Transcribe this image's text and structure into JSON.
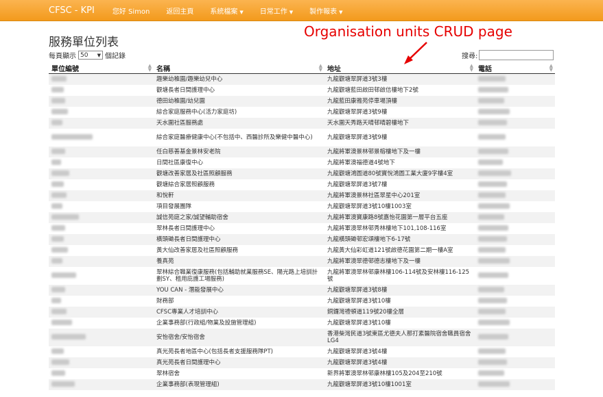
{
  "nav": {
    "brand": "CFSC - KPI",
    "greeting": "您好 Simon",
    "items": [
      {
        "label": "返回主頁",
        "dropdown": false
      },
      {
        "label": "系統檔案",
        "dropdown": true
      },
      {
        "label": "日常工作",
        "dropdown": true
      },
      {
        "label": "製作報表",
        "dropdown": true
      }
    ]
  },
  "annotation": {
    "text": "Organisation units CRUD page",
    "color": "#e60000"
  },
  "page": {
    "title": "服務單位列表",
    "page_size_prefix": "每頁顯示",
    "page_size_value": "50",
    "page_size_suffix": "個記錄",
    "search_label": "搜尋:"
  },
  "table": {
    "headers": [
      "單位編號",
      "名稱",
      "地址",
      "電話"
    ],
    "rows": [
      {
        "h": 16,
        "name": "趣樂幼稚園/趣樂幼兒中心",
        "address": "九龍觀塘翠屏道3號3樓"
      },
      {
        "h": 16,
        "name": "觀塘長者日間護理中心",
        "address": "九龍觀塘藍田啟田邨啟信樓地下2號"
      },
      {
        "h": 16,
        "name": "德田幼稚園/幼兒園",
        "address": "九龍藍田康雅苑停車場頂樓"
      },
      {
        "h": 16,
        "name": "綜合家庭服務中心(活力家庭坊)",
        "address": "九龍觀塘翠屏道3號9樓"
      },
      {
        "h": 16,
        "name": "天水圍社區服務處",
        "address": "天水圍天秀路天晴邨晴碧樓地下"
      },
      {
        "h": 26,
        "name": "綜合家庭醫療健康中心(不包括中、西醫診所及樂健中醫中心)",
        "address": "九龍觀塘翠屏道3號9樓"
      },
      {
        "h": 16,
        "name": "任白慈善基金景林安老院",
        "address": "九龍將軍澳景林邨景榕樓地下及一樓"
      },
      {
        "h": 16,
        "name": "日間社區康復中心",
        "address": "九龍將軍澳福德道4號地下"
      },
      {
        "h": 16,
        "name": "觀塘改善家居及社區照顧服務",
        "address": "九龍觀塘鴻圖道80號寶悅鴻圖工業大廈9字樓4室"
      },
      {
        "h": 16,
        "name": "觀塘綜合家居照顧服務",
        "address": "九龍觀塘翠屏道3號7樓"
      },
      {
        "h": 16,
        "name": "和悅軒",
        "address": "九龍將軍澳景林社區翠星中心201室"
      },
      {
        "h": 16,
        "name": "項目發展團隊",
        "address": "九龍觀塘翠屏道3號10樓1003室"
      },
      {
        "h": 16,
        "name": "誠信苑庭之家/誠望輔助宿舍",
        "address": "九龍將軍澳寶康路8號嘉怡花園第一層平台五座"
      },
      {
        "h": 16,
        "name": "翠林長者日間護理中心",
        "address": "九龍將軍澳翠林邨秀林樓地下101,108-116室"
      },
      {
        "h": 16,
        "name": "橫頭磡長者日間護理中心",
        "address": "九龍橫頭磡邨宏頌樓地下6-17號"
      },
      {
        "h": 16,
        "name": "黃大仙改善家居及社區照顧服務",
        "address": "九龍黃大仙彩虹道121號啟德花園第二期一樓A室"
      },
      {
        "h": 16,
        "name": "養真苑",
        "address": "九龍將軍澳翠德邨德志樓地下及一樓"
      },
      {
        "h": 26,
        "name": "翠林綜合職業復康服務(包括輔助就業服務SE、陽光路上培訓計劃SY、租用庇護工場服務)",
        "address": "九龍將軍澳翠林邨康林樓106-114號及安林樓116-125號"
      },
      {
        "h": 16,
        "name": "YOU CAN - 潛能發展中心",
        "address": "九龍觀塘翠屏道3號8樓"
      },
      {
        "h": 16,
        "name": "財務部",
        "address": "九龍觀塘翠屏道3號10樓"
      },
      {
        "h": 16,
        "name": "CFSC專業人才培訓中心",
        "address": "銅鑼灣禮頓道119號20樓全層"
      },
      {
        "h": 16,
        "name": "企業事務部(行政組/物業及設施管理組)",
        "address": "九龍觀塘翠屏道3號10樓"
      },
      {
        "h": 26,
        "name": "安怡宿舍/安怡宿舍",
        "address": "香港柴灣民道3號東區尤德夫人那打素醫院宿舍職員宿舍LG4"
      },
      {
        "h": 16,
        "name": "真光苑長者地區中心(包括長者支援服務隊PT)",
        "address": "九龍觀塘翠屏道3號4樓"
      },
      {
        "h": 16,
        "name": "真光苑長者日間護理中心",
        "address": "九龍觀塘翠屏道3號4樓"
      },
      {
        "h": 16,
        "name": "翠林宿舍",
        "address": "新界將軍澳翠林邨康林樓105及204至210號"
      },
      {
        "h": 16,
        "name": "企業事務部(表現管理組)",
        "address": "九龍觀塘翠屏道3號10樓1001室"
      }
    ]
  }
}
